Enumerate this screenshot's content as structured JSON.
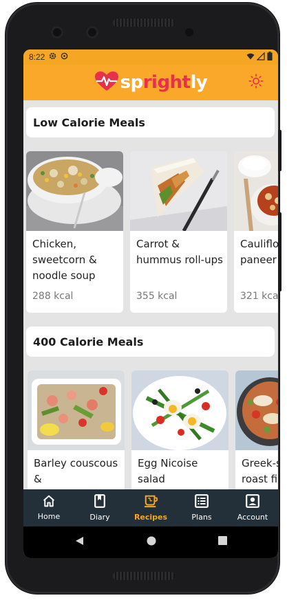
{
  "status_bar": {
    "time": "8:22"
  },
  "app_bar": {
    "logo_parts": [
      "sp",
      "right",
      "ly"
    ]
  },
  "sections": [
    {
      "title": "Low Calorie Meals",
      "cards": [
        {
          "title": " Chicken, sweetcorn & noodle soup",
          "kcal": "288 kcal",
          "image": "soup-bowl"
        },
        {
          "title": "Carrot & hummus roll-ups",
          "kcal": "355 kcal",
          "image": "wrap-rollup"
        },
        {
          "title": "Cauliflower paneer curry",
          "kcal": "321 kcal",
          "image": "curry-rice"
        }
      ]
    },
    {
      "title": "400 Calorie Meals",
      "cards": [
        {
          "title": "Barley couscous &",
          "image": "barley-salad"
        },
        {
          "title": "Egg Nicoise salad",
          "image": "nicoise-salad"
        },
        {
          "title": "Greek-style roast fish",
          "image": "roast-fish"
        }
      ]
    }
  ],
  "bottom_nav": [
    {
      "label": "Home",
      "icon": "home-icon"
    },
    {
      "label": "Diary",
      "icon": "diary-icon"
    },
    {
      "label": "Recipes",
      "icon": "recipes-icon",
      "active": true
    },
    {
      "label": "Plans",
      "icon": "plans-icon"
    },
    {
      "label": "Account",
      "icon": "account-icon"
    }
  ],
  "colors": {
    "accent": "#f5a623",
    "brand_red": "#e8304a",
    "nav_bg": "#23303a",
    "content_bg": "#e4e4e4"
  }
}
